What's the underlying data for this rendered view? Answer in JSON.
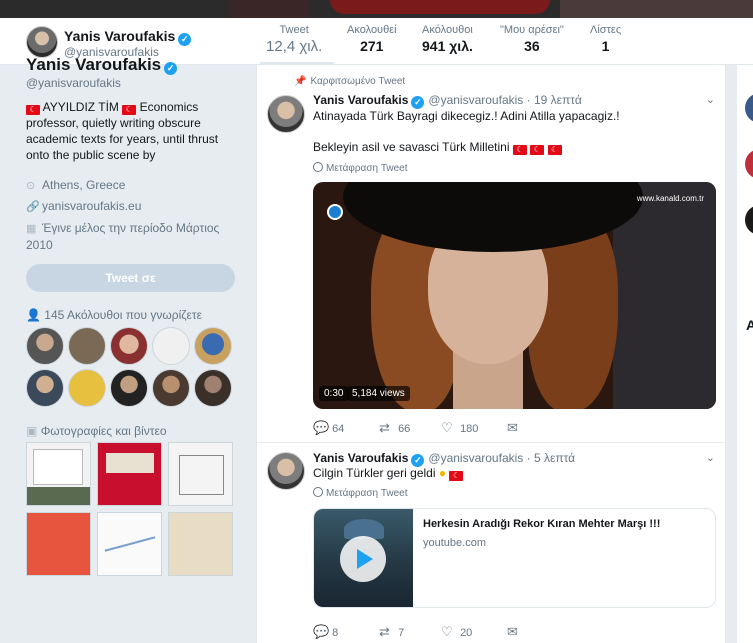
{
  "profile": {
    "name": "Yanis Varoufakis",
    "handle": "@yanisvaroufakis",
    "bio_flag_text": "AYYILDIZ TİM",
    "bio_rest": "Economics professor, quietly writing obscure academic texts for years, until thrust onto the public scene by",
    "location": "Athens, Greece",
    "url": "yanisvaroufakis.eu",
    "joined": "Έγινε μέλος την περίοδο Μάρτιος 2010",
    "tweet_to_label": "Tweet σε",
    "followers_you_know": "145 Ακόλουθοι που γνωρίζετε",
    "photos_videos": "Φωτογραφίες και βίντεο"
  },
  "stats": [
    {
      "label": "Tweet",
      "value": "12,4 χιλ."
    },
    {
      "label": "Ακολουθεί",
      "value": "271"
    },
    {
      "label": "Ακόλουθοι",
      "value": "941 χιλ."
    },
    {
      "label": "\"Μου αρέσει\"",
      "value": "36"
    },
    {
      "label": "Λίστες",
      "value": "1"
    }
  ],
  "tweets": [
    {
      "pinned_label": "Καρφιτσωμένο Tweet",
      "name": "Yanis Varoufakis",
      "handle": "@yanisvaroufakis",
      "time": "· 19 λεπτά",
      "line1": "Atinayada Türk Bayragi dikecegiz.! Adini Atilla yapacagiz.!",
      "line2": "Bekleyin asil ve savasci Türk Milletini",
      "translate": "Μετάφραση Tweet",
      "video": {
        "duration": "0:30",
        "views": "5,184 views",
        "watermark": "www.kanald.com.tr"
      },
      "replies": "64",
      "retweets": "66",
      "likes": "180"
    },
    {
      "name": "Yanis Varoufakis",
      "handle": "@yanisvaroufakis",
      "time": "· 5 λεπτά",
      "line1": "Cilgin Türkler geri geldi",
      "translate": "Μετάφραση Tweet",
      "card": {
        "title": "Herkesin Aradığı Rekor Kıran Mehter Marşı !!!",
        "domain": "youtube.com"
      },
      "replies": "8",
      "retweets": "7",
      "likes": "20"
    }
  ],
  "colors": {
    "accent": "#1da1f2",
    "background": "#e6ecf0",
    "turkish_red": "#e30a17"
  }
}
